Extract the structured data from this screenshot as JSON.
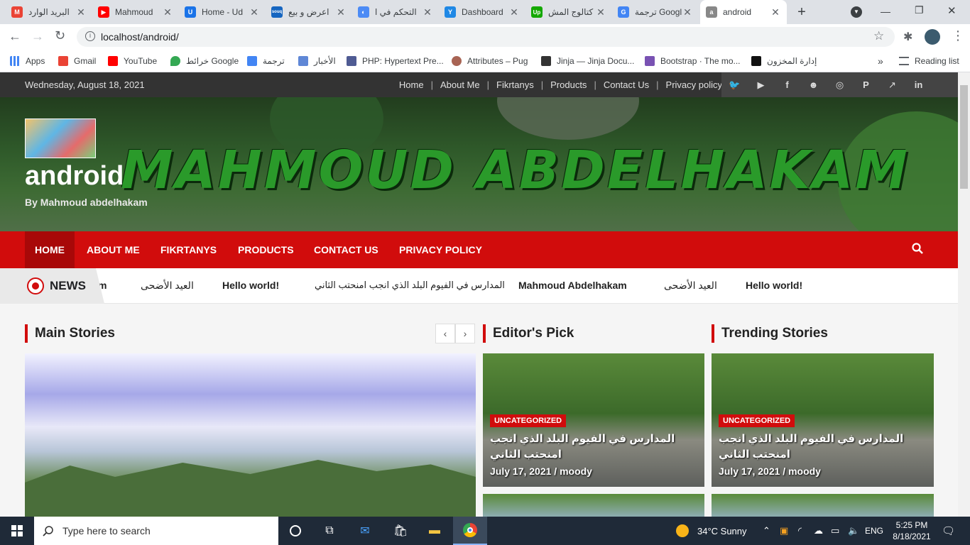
{
  "browser": {
    "tabs": [
      {
        "title": "البريد الوارد",
        "fav_color": "#ea4335",
        "fav_text": "M"
      },
      {
        "title": "Mahmoud",
        "fav_color": "#ff0000",
        "fav_text": "▶"
      },
      {
        "title": "Home - Ud",
        "fav_color": "#1a73e8",
        "fav_text": "U"
      },
      {
        "title": "اعرض و بيع",
        "fav_color": "#1565c0",
        "fav_text": "souq"
      },
      {
        "title": "التحكم في ا",
        "fav_color": "#4c8bf5",
        "fav_text": "◐"
      },
      {
        "title": "Dashboard",
        "fav_color": "#1f88e5",
        "fav_text": "Y"
      },
      {
        "title": "كتالوج المش",
        "fav_color": "#14a800",
        "fav_text": "Up"
      },
      {
        "title": "ترجمة Google",
        "fav_color": "#4285f4",
        "fav_text": "G"
      },
      {
        "title": "android",
        "fav_color": "#888888",
        "fav_text": "a"
      }
    ],
    "new_tab": "+",
    "url": "localhost/android/",
    "bookmarks": [
      {
        "label": "Apps",
        "color": "#4285f4"
      },
      {
        "label": "Gmail",
        "color": "#ea4335"
      },
      {
        "label": "YouTube",
        "color": "#ff0000"
      },
      {
        "label": "خرائط Google",
        "color": "#34a853"
      },
      {
        "label": "ترجمة",
        "color": "#4285f4"
      },
      {
        "label": "الأخبار",
        "color": "#5f87d6"
      },
      {
        "label": "PHP: Hypertext Pre...",
        "color": "#4f5b93"
      },
      {
        "label": "Attributes – Pug",
        "color": "#a86454"
      },
      {
        "label": "Jinja — Jinja Docu...",
        "color": "#333333"
      },
      {
        "label": "Bootstrap · The mo...",
        "color": "#7952b3"
      },
      {
        "label": "إدارة المخزون",
        "color": "#111111"
      }
    ],
    "bookmarks_more": "»",
    "reading_list": "Reading list"
  },
  "site": {
    "date": "Wednesday, August 18, 2021",
    "top_menu": [
      "Home",
      "About Me",
      "Fikrtanys",
      "Products",
      "Contact Us",
      "Privacy policy"
    ],
    "social": [
      "twitter-icon",
      "youtube-icon",
      "facebook-icon",
      "snapchat-icon",
      "instagram-icon",
      "pinterest-icon",
      "external-link-icon",
      "linkedin-icon"
    ],
    "banner_text": "MAHMOUD ABDELHAKAM",
    "title": "android",
    "tagline": "By Mahmoud abdelhakam",
    "nav": [
      "HOME",
      "ABOUT ME",
      "FIKRTANYS",
      "PRODUCTS",
      "CONTACT US",
      "PRIVACY POLICY"
    ],
    "news_label": "NEWS",
    "ticker": [
      "m",
      "العيد الأضحى",
      "Hello world!",
      "المدارس في الفيوم البلد الذي انجب امنحتب الثاني",
      "Mahmoud Abdelhakam",
      "العيد الأضحى",
      "Hello world!"
    ],
    "sections": {
      "main": "Main Stories",
      "editors": "Editor's Pick",
      "trending": "Trending Stories"
    },
    "cards": [
      {
        "badge": "UNCATEGORIZED",
        "title": "المدارس في الفيوم البلد الذي انجب امنحتب الثاني",
        "meta": "July 17, 2021 / moody"
      },
      {
        "badge": "UNCATEGORIZED",
        "title": "المدارس في الفيوم البلد الذي انجب امنحتب الثاني",
        "meta": "July 17, 2021 / moody"
      }
    ]
  },
  "taskbar": {
    "search_placeholder": "Type here to search",
    "weather": "34°C  Sunny",
    "lang": "ENG",
    "time": "5:25 PM",
    "date": "8/18/2021"
  }
}
